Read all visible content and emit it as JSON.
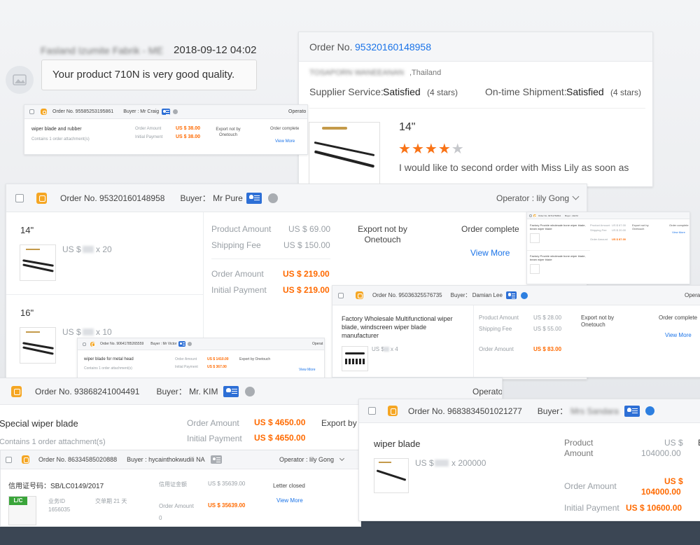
{
  "review": {
    "reviewer_name": "Fasland Izumite Fabrik - ME",
    "date": "2018-09-12 04:02",
    "comment": "Your product 710N is very good quality."
  },
  "review2": {
    "order_label": "Order No.",
    "order_no": "95320160148958",
    "buyer_name": "TOSAPORN WANEEANAN",
    "buyer_country": ",Thailand",
    "supplier_service_label": "Supplier Service:",
    "supplier_service_value": "Satisfied",
    "supplier_service_stars": "(4 stars)",
    "shipment_label": "On-time Shipment:",
    "shipment_value": "Satisfied",
    "shipment_stars": "(4 stars)",
    "product_size": "14\"",
    "rating": 4,
    "comment": "I would like to second order with Miss Lily as soon as"
  },
  "order_craig": {
    "order_no": "Order No. 95585253195861",
    "buyer": "Buyer : Mr Craig",
    "operator": "Operato",
    "product": "wiper blade and rubber",
    "attachment": "Contains 1 order attachment(s)",
    "order_amount_label": "Order Amount",
    "order_amount": "US $ 38.00",
    "initial_payment_label": "Initial Payment",
    "initial_payment": "US $ 38.00",
    "export": "Export not by Onetouch",
    "status": "Order complete",
    "view_more": "View More"
  },
  "order_pure": {
    "order_no": "Order No. 95320160148958",
    "buyer": "Buyer： Mr Pure",
    "operator": "Operator : lily Gong",
    "items": [
      {
        "size": "14\"",
        "price": "US $",
        "qty": "x 20"
      },
      {
        "size": "16\"",
        "price": "US $",
        "qty": "x 10"
      }
    ],
    "product_amount_label": "Product Amount",
    "product_amount": "US $ 69.00",
    "shipping_fee_label": "Shipping Fee",
    "shipping_fee": "US $ 150.00",
    "order_amount_label": "Order Amount",
    "order_amount": "US $ 219.00",
    "initial_payment_label": "Initial Payment",
    "initial_payment": "US $ 219.00",
    "export": "Export not by Onetouch",
    "status": "Order complete",
    "view_more": "View More"
  },
  "order_tiny": {
    "order_no": "Order No. 94711762812",
    "buyer": "Buyer : Aldi M",
    "product1": "Factory Provide wholesale bone wiper blade, beam wiper blade",
    "product2": "Factory Provide wholesale bone wiper blade, beam wiper blade",
    "product_amount_label": "Product Amount",
    "product_amount": "US $ 67.00",
    "shipping_fee_label": "Shipping Fee",
    "shipping_fee": "US $ 20.00",
    "order_amount_label": "Order Amount",
    "order_amount": "US $ 87.00",
    "export": "Export not by Onetouch",
    "status": "Order complete",
    "view_more": "View More"
  },
  "order_damian": {
    "order_no": "Order No. 95036325576735",
    "buyer": "Buyer： Damian Lee",
    "operator": "Opera",
    "product": "Factory Wholesale Multifunctional wiper blade, windscreen wiper blade manufacturer",
    "price": "US $",
    "qty": "x 4",
    "product_amount_label": "Product Amount",
    "product_amount": "US $ 28.00",
    "shipping_fee_label": "Shipping Fee",
    "shipping_fee": "US $ 55.00",
    "order_amount_label": "Order Amount",
    "order_amount": "US $ 83.00",
    "export": "Export not by Onetouch",
    "status": "Order complete",
    "view_more": "View More"
  },
  "order_victor": {
    "order_no": "Order No. 90641785265559",
    "buyer": "Buyer : Mr Victor",
    "operator": "Operat",
    "product": "wiper blade for metal head",
    "attachment": "Contains 1 order attachment(s)",
    "order_amount_label": "Order Amount",
    "order_amount": "US $ 1410.00",
    "initial_payment_label": "Initial Payment",
    "initial_payment": "US $ 367.00",
    "export": "Export by Onetouch",
    "view_more": "View More"
  },
  "order_kim": {
    "order_no": "Order No. 93868241004491",
    "buyer": "Buyer： Mr. KIM",
    "operator": "Operato",
    "product": "Special wiper blade",
    "attachment": "Contains 1 order attachment(s)",
    "order_amount_label": "Order Amount",
    "order_amount": "US $ 4650.00",
    "initial_payment_label": "Initial Payment",
    "initial_payment": "US $ 4650.00",
    "export": "Export by"
  },
  "order_lc": {
    "order_no": "Order No. 86334585020888",
    "buyer": "Buyer : hycainthokwudili NA",
    "operator": "Operator : lily Gong",
    "credit_no_label": "信用证号码：SB/LC0149/2017",
    "credit_amount_label": "信用证金额",
    "credit_amount": "US $ 35639.00",
    "business_id_label": "业务ID",
    "business_id": "1656035",
    "delivery": "交单期 21 天",
    "order_amount_label": "Order Amount",
    "order_amount": "US $ 35639.00",
    "status": "Letter closed",
    "view_more": "View More",
    "lc_badge": "L/C",
    "zero": "0"
  },
  "order_sandara": {
    "order_no": "Order No. 9683834501021277",
    "buyer_label": "Buyer：",
    "buyer_name": "Mrs Sandara",
    "product": "wiper blade",
    "price": "US $",
    "qty": "x 200000",
    "product_amount_label": "Product Amount",
    "product_amount_a": "US $",
    "product_amount_b": "104000.00",
    "order_amount_label": "Order Amount",
    "order_amount_a": "US $",
    "order_amount_b": "104000.00",
    "initial_payment_label": "Initial Payment",
    "initial_payment": "US $ 10600.00",
    "cut": "E"
  },
  "colors": {
    "accent_orange": "#ff6a00",
    "link_blue": "#1a73e8",
    "badge_orange": "#f5a623"
  }
}
